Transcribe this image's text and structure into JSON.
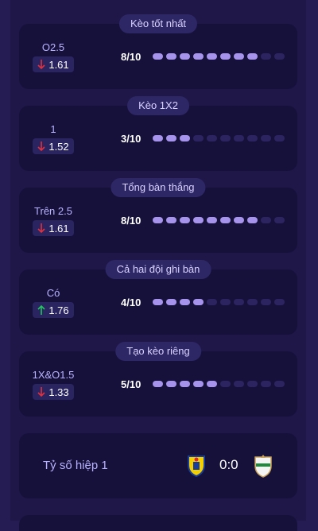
{
  "cards": [
    {
      "label": "Kèo tốt nhất",
      "selection": "O2.5",
      "odds": "1.61",
      "trend": "down",
      "rating": "8/10",
      "filled": 8
    },
    {
      "label": "Kèo 1X2",
      "selection": "1",
      "odds": "1.52",
      "trend": "down",
      "rating": "3/10",
      "filled": 3
    },
    {
      "label": "Tổng bàn thắng",
      "selection": "Trên 2.5",
      "odds": "1.61",
      "trend": "down",
      "rating": "8/10",
      "filled": 8
    },
    {
      "label": "Cả hai đội ghi bàn",
      "selection": "Có",
      "odds": "1.76",
      "trend": "up",
      "rating": "4/10",
      "filled": 4
    },
    {
      "label": "Tạo kèo riêng",
      "selection": "1X&O1.5",
      "odds": "1.33",
      "trend": "down",
      "rating": "5/10",
      "filled": 5
    }
  ],
  "rating_scale": 10,
  "halftime": {
    "label": "Tỷ số hiệp 1",
    "score": "0:0",
    "home_crest": "villarreal-crest-icon",
    "away_crest": "elche-crest-icon"
  },
  "colors": {
    "background": "#241c52",
    "card": "#16113a",
    "dot_on": "#a693ec",
    "dot_off": "#2b2460",
    "arrow_down": "#e0313f",
    "arrow_up": "#22c55e"
  }
}
